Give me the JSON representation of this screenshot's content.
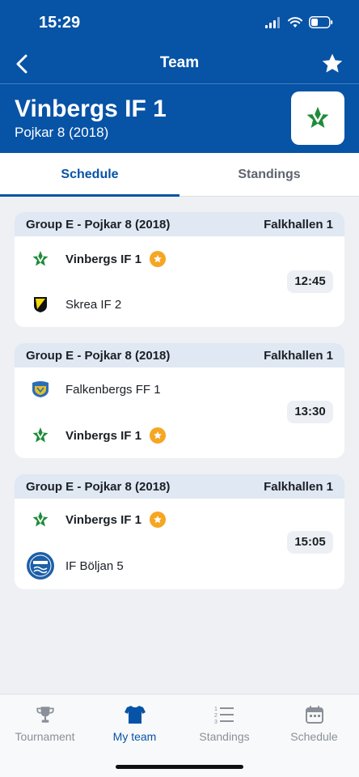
{
  "status": {
    "time": "15:29"
  },
  "nav": {
    "title": "Team"
  },
  "team": {
    "name": "Vinbergs IF 1",
    "subtitle": "Pojkar 8 (2018)"
  },
  "tabs": [
    {
      "label": "Schedule",
      "active": true
    },
    {
      "label": "Standings",
      "active": false
    }
  ],
  "matches": [
    {
      "group": "Group E - Pojkar 8 (2018)",
      "venue": "Falkhallen 1",
      "time": "12:45",
      "home": {
        "name": "Vinbergs IF 1",
        "favorite": true,
        "logo": "vinbergs-logo"
      },
      "away": {
        "name": "Skrea IF 2",
        "favorite": false,
        "logo": "skrea-logo"
      }
    },
    {
      "group": "Group E - Pojkar 8 (2018)",
      "venue": "Falkhallen 1",
      "time": "13:30",
      "home": {
        "name": "Falkenbergs FF 1",
        "favorite": false,
        "logo": "falkenbergs-logo"
      },
      "away": {
        "name": "Vinbergs IF 1",
        "favorite": true,
        "logo": "vinbergs-logo"
      }
    },
    {
      "group": "Group E - Pojkar 8 (2018)",
      "venue": "Falkhallen 1",
      "time": "15:05",
      "home": {
        "name": "Vinbergs IF 1",
        "favorite": true,
        "logo": "vinbergs-logo"
      },
      "away": {
        "name": "IF Böljan 5",
        "favorite": false,
        "logo": "boljan-logo"
      }
    }
  ],
  "bottom_nav": [
    {
      "label": "Tournament",
      "icon": "trophy-icon",
      "active": false
    },
    {
      "label": "My team",
      "icon": "shirt-icon",
      "active": true
    },
    {
      "label": "Standings",
      "icon": "list-icon",
      "active": false
    },
    {
      "label": "Schedule",
      "icon": "calendar-icon",
      "active": false
    }
  ],
  "colors": {
    "primary": "#0753a6",
    "favorite": "#f5a623",
    "card_header": "#dfe8f3"
  }
}
